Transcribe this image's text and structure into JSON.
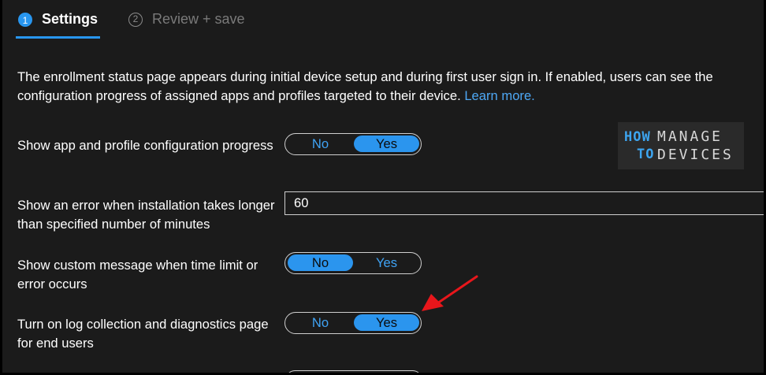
{
  "tabs": [
    {
      "number": "1",
      "label": "Settings"
    },
    {
      "number": "2",
      "label": "Review + save"
    }
  ],
  "description": {
    "text": "The enrollment status page appears during initial device setup and during first user sign in. If enabled, users can see the configuration progress of assigned apps and profiles targeted to their device.",
    "link": "Learn more."
  },
  "settings": [
    {
      "label": "Show app and profile configuration progress",
      "no": "No",
      "yes": "Yes",
      "selected": "Yes"
    },
    {
      "label": "Show an error when installation takes longer than specified number of minutes",
      "value": "60"
    },
    {
      "label": "Show custom message when time limit or error occurs",
      "no": "No",
      "yes": "Yes",
      "selected": "No"
    },
    {
      "label": "Turn on log collection and diagnostics page for end users",
      "no": "No",
      "yes": "Yes",
      "selected": "Yes"
    }
  ],
  "watermark": {
    "line1_a": "HOW",
    "line1_b": "MANAGE",
    "line2_a": "TO",
    "line2_b": "DEVICES"
  },
  "colors": {
    "accent": "#2b95ee",
    "background": "#1b1b1b",
    "annotation_arrow": "#e8161b"
  }
}
